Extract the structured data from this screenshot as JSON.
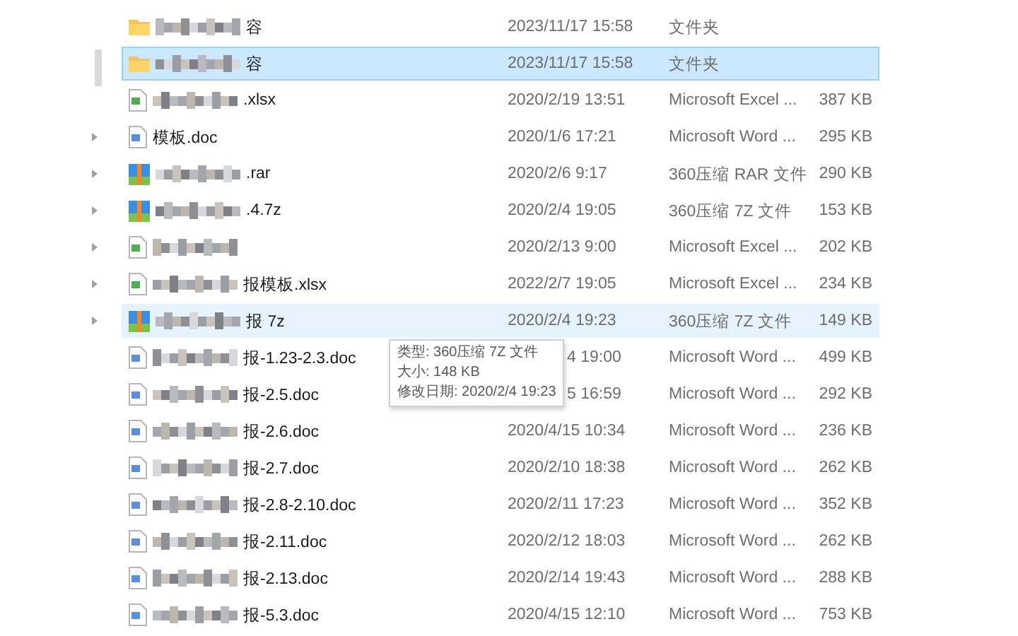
{
  "files": [
    {
      "kind": "folder",
      "redacted": true,
      "name": "容",
      "date": "2023/11/17 15:58",
      "type": "文件夹",
      "date_covered": false,
      "selected": false,
      "hover": false,
      "tree_arrow": false
    },
    {
      "kind": "folder",
      "redacted": true,
      "name": "容",
      "date": "2023/11/17 15:58",
      "type": "文件夹",
      "date_covered": false,
      "selected": true,
      "hover": false,
      "tree_arrow": false
    },
    {
      "kind": "excel",
      "redacted": true,
      "name": ".xlsx",
      "date": "2020/2/19 13:51",
      "date_covered": false,
      "type": "Microsoft Excel ...",
      "size": "387 KB",
      "selected": false,
      "hover": false,
      "tree_arrow": false
    },
    {
      "kind": "word",
      "redacted": false,
      "name": "模板.doc",
      "date": "2020/1/6 17:21",
      "date_covered": false,
      "type": "Microsoft Word ...",
      "size": "295 KB",
      "selected": false,
      "hover": false,
      "tree_arrow": true
    },
    {
      "kind": "archive",
      "redacted": true,
      "name": ".rar",
      "date": "2020/2/6 9:17",
      "date_covered": false,
      "type": "360压缩 RAR 文件",
      "size": "290 KB",
      "selected": false,
      "hover": false,
      "tree_arrow": true
    },
    {
      "kind": "archive",
      "redacted": true,
      "name": ".4.7z",
      "date": "2020/2/4 19:05",
      "date_covered": false,
      "type": "360压缩 7Z 文件",
      "size": "153 KB",
      "selected": false,
      "hover": false,
      "tree_arrow": true
    },
    {
      "kind": "excel",
      "redacted": true,
      "date": "2020/2/13 9:00",
      "date_covered": false,
      "type": "Microsoft Excel ...",
      "size": "202 KB",
      "selected": false,
      "hover": false,
      "tree_arrow": true
    },
    {
      "kind": "excel",
      "redacted": true,
      "name": "报模板.xlsx",
      "date": "2022/2/7 19:05",
      "date_covered": false,
      "type": "Microsoft Excel ...",
      "size": "234 KB",
      "selected": false,
      "hover": false,
      "tree_arrow": true
    },
    {
      "kind": "archive",
      "redacted": true,
      "name": "报 7z",
      "date": "2020/2/4 19:23",
      "date_covered": false,
      "type": "360压缩 7Z 文件",
      "size": "149 KB",
      "selected": false,
      "hover": true,
      "tree_arrow": true
    },
    {
      "kind": "word",
      "redacted": true,
      "name": "报-1.23-2.3.doc",
      "date": "4 19:00",
      "date_covered": true,
      "type": "Microsoft Word ...",
      "size": "499 KB",
      "selected": false,
      "hover": false,
      "tree_arrow": false
    },
    {
      "kind": "word",
      "redacted": true,
      "name": "报-2.5.doc",
      "date": "5 16:59",
      "date_covered": true,
      "type": "Microsoft Word ...",
      "size": "292 KB",
      "selected": false,
      "hover": false,
      "tree_arrow": false
    },
    {
      "kind": "word",
      "redacted": true,
      "name": "报-2.6.doc",
      "date": "2020/4/15 10:34",
      "date_covered": false,
      "type": "Microsoft Word ...",
      "size": "236 KB",
      "selected": false,
      "hover": false,
      "tree_arrow": false
    },
    {
      "kind": "word",
      "redacted": true,
      "name": "报-2.7.doc",
      "date": "2020/2/10 18:38",
      "date_covered": false,
      "type": "Microsoft Word ...",
      "size": "262 KB",
      "selected": false,
      "hover": false,
      "tree_arrow": false
    },
    {
      "kind": "word",
      "redacted": true,
      "name": "报-2.8-2.10.doc",
      "date": "2020/2/11 17:23",
      "date_covered": false,
      "type": "Microsoft Word ...",
      "size": "352 KB",
      "selected": false,
      "hover": false,
      "tree_arrow": false
    },
    {
      "kind": "word",
      "redacted": true,
      "name": "报-2.11.doc",
      "date": "2020/2/12 18:03",
      "date_covered": false,
      "type": "Microsoft Word ...",
      "size": "262 KB",
      "selected": false,
      "hover": false,
      "tree_arrow": false
    },
    {
      "kind": "word",
      "redacted": true,
      "name": "报-2.13.doc",
      "date": "2020/2/14 19:43",
      "date_covered": false,
      "type": "Microsoft Word ...",
      "size": "288 KB",
      "selected": false,
      "hover": false,
      "tree_arrow": false
    },
    {
      "kind": "word",
      "redacted": true,
      "name": "报-5.3.doc",
      "date": "2020/4/15 12:10",
      "date_covered": false,
      "type": "Microsoft Word ...",
      "size": "753 KB",
      "selected": false,
      "hover": false,
      "tree_arrow": false
    }
  ],
  "tooltip": {
    "lines": [
      "类型: 360压缩 7Z 文件",
      "大小: 148 KB",
      "修改日期: 2020/2/4 19:23"
    ]
  }
}
